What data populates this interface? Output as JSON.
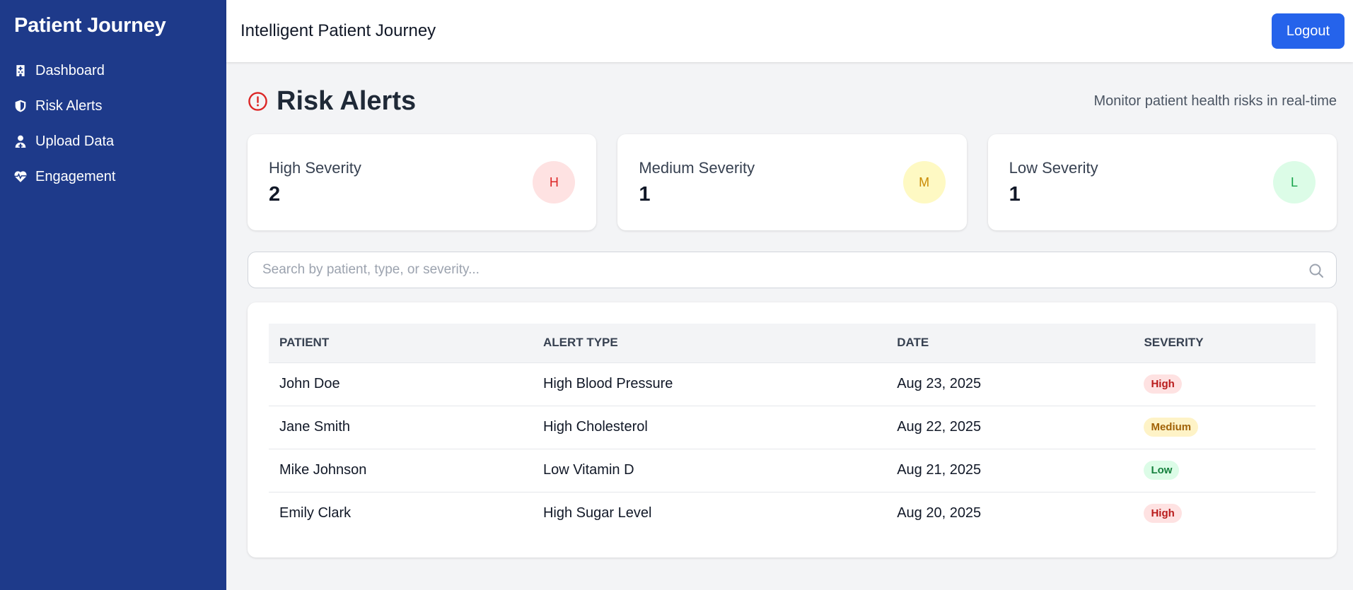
{
  "sidebar": {
    "brand": "Patient Journey",
    "items": [
      {
        "label": "Dashboard",
        "icon": "hospital-icon"
      },
      {
        "label": "Risk Alerts",
        "icon": "shield-icon"
      },
      {
        "label": "Upload Data",
        "icon": "doctor-icon"
      },
      {
        "label": "Engagement",
        "icon": "heartbeat-icon"
      }
    ]
  },
  "topbar": {
    "title": "Intelligent Patient Journey",
    "logout_label": "Logout"
  },
  "page": {
    "title": "Risk Alerts",
    "subtitle": "Monitor patient health risks in real-time"
  },
  "summary": [
    {
      "label": "High Severity",
      "value": "2",
      "letter": "H",
      "bg": "#fee2e2",
      "fg": "#dc2626"
    },
    {
      "label": "Medium Severity",
      "value": "1",
      "letter": "M",
      "bg": "#fef9c3",
      "fg": "#ca8a04"
    },
    {
      "label": "Low Severity",
      "value": "1",
      "letter": "L",
      "bg": "#dcfce7",
      "fg": "#16a34a"
    }
  ],
  "search": {
    "placeholder": "Search by patient, type, or severity...",
    "value": ""
  },
  "table": {
    "headers": [
      "PATIENT",
      "ALERT TYPE",
      "DATE",
      "SEVERITY"
    ],
    "rows": [
      {
        "patient": "John Doe",
        "type": "High Blood Pressure",
        "date": "Aug 23, 2025",
        "severity": "High"
      },
      {
        "patient": "Jane Smith",
        "type": "High Cholesterol",
        "date": "Aug 22, 2025",
        "severity": "Medium"
      },
      {
        "patient": "Mike Johnson",
        "type": "Low Vitamin D",
        "date": "Aug 21, 2025",
        "severity": "Low"
      },
      {
        "patient": "Emily Clark",
        "type": "High Sugar Level",
        "date": "Aug 20, 2025",
        "severity": "High"
      }
    ]
  },
  "colors": {
    "sidebar_bg": "#1e3a8a",
    "accent": "#2563eb",
    "alert_red": "#dc2626"
  }
}
